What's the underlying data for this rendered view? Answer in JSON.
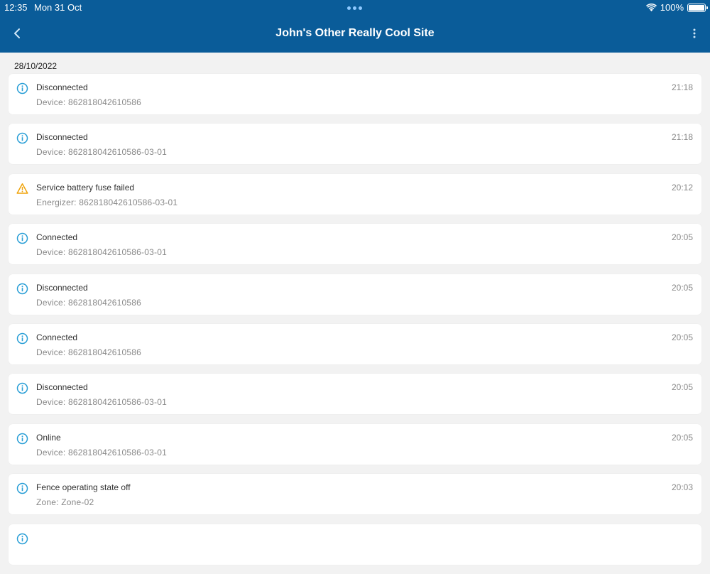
{
  "status_bar": {
    "time": "12:35",
    "date": "Mon 31 Oct",
    "battery": "100%"
  },
  "header": {
    "title": "John's Other Really Cool Site",
    "color": "#0a5c99"
  },
  "date_group": "28/10/2022",
  "events": [
    {
      "icon": "info-icon",
      "title": "Disconnected",
      "subtitle": "Device: 862818042610586",
      "time": "21:18"
    },
    {
      "icon": "info-icon",
      "title": "Disconnected",
      "subtitle": "Device: 862818042610586-03-01",
      "time": "21:18"
    },
    {
      "icon": "warning-icon",
      "title": "Service battery fuse failed",
      "subtitle": "Energizer: 862818042610586-03-01",
      "time": "20:12"
    },
    {
      "icon": "info-icon",
      "title": "Connected",
      "subtitle": "Device: 862818042610586-03-01",
      "time": "20:05"
    },
    {
      "icon": "info-icon",
      "title": "Disconnected",
      "subtitle": "Device: 862818042610586",
      "time": "20:05"
    },
    {
      "icon": "info-icon",
      "title": "Connected",
      "subtitle": "Device: 862818042610586",
      "time": "20:05"
    },
    {
      "icon": "info-icon",
      "title": "Disconnected",
      "subtitle": "Device: 862818042610586-03-01",
      "time": "20:05"
    },
    {
      "icon": "info-icon",
      "title": "Online",
      "subtitle": "Device: 862818042610586-03-01",
      "time": "20:05"
    },
    {
      "icon": "info-icon",
      "title": "Fence operating state off",
      "subtitle": "Zone: Zone-02",
      "time": "20:03"
    },
    {
      "icon": "info-icon",
      "title": "",
      "subtitle": "",
      "time": ""
    }
  ],
  "colors": {
    "info": "#2a9fd6",
    "warning": "#f0a30a"
  }
}
